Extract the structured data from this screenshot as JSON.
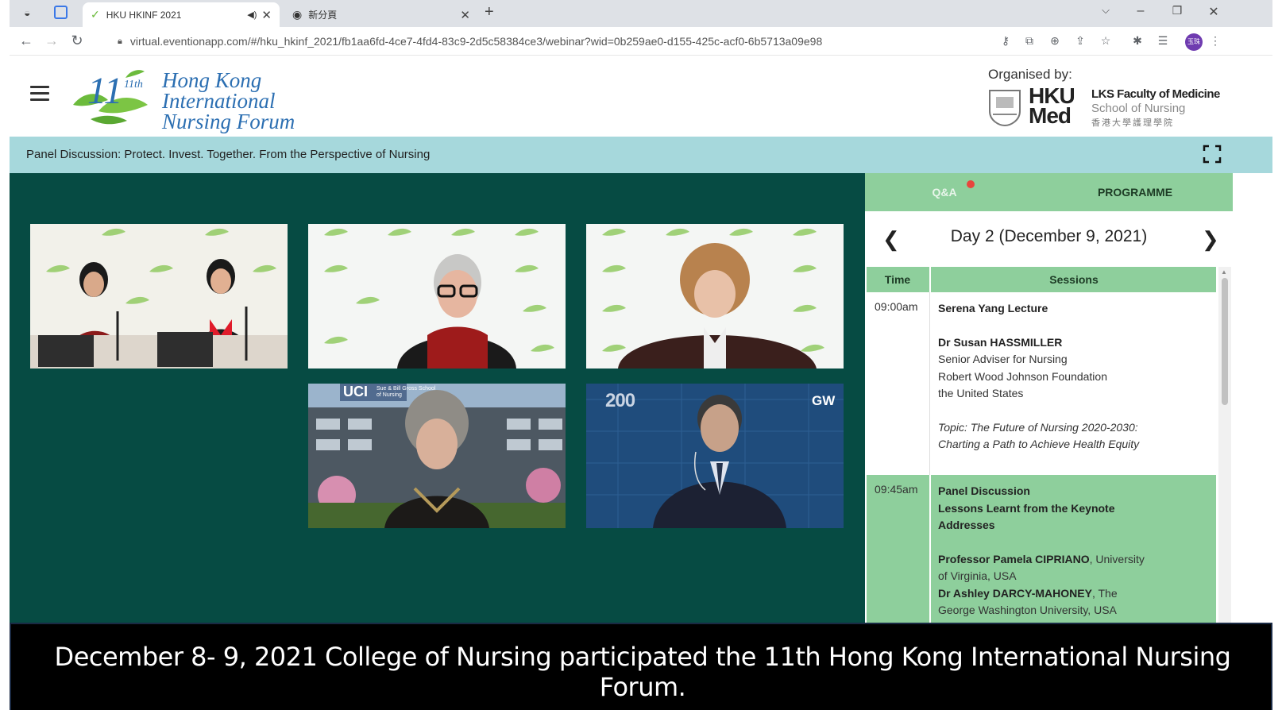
{
  "browser": {
    "active_tab_title": "HKU HKINF 2021",
    "new_tab_title": "新分頁",
    "url": "virtual.eventionapp.com/#/hku_hkinf_2021/fb1aa6fd-4ce7-4fd4-83c9-2d5c58384ce3/webinar?wid=0b259ae0-d155-425c-acf0-6b5713a09e98",
    "profile_initials": "玉珠"
  },
  "header": {
    "logo_text": [
      "Hong Kong",
      "International",
      "Nursing Forum"
    ],
    "logo_edition": "11th",
    "organised_by": "Organised by:",
    "org_hku": "HKU",
    "org_med": "Med",
    "org_faculty": "LKS Faculty of Medicine",
    "org_school": "School of Nursing",
    "org_chinese": "香港大學護理學院"
  },
  "session": {
    "title": "Panel Discussion: Protect. Invest. Together. From the Perspective of Nursing"
  },
  "video_tiles": {
    "uci_label": "UCI",
    "uci_sub": "Sue & Bill Gross School of Nursing",
    "gw_label": "GW",
    "gw_anniv": "200"
  },
  "panel": {
    "tab_qa": "Q&A",
    "tab_programme": "PROGRAMME",
    "day_title": "Day 2 (December 9, 2021)",
    "col_time": "Time",
    "col_sessions": "Sessions",
    "rows": [
      {
        "time": "09:00am",
        "lecture": "Serena Yang Lecture",
        "speaker": "Dr Susan HASSMILLER",
        "role": "Senior Adviser for Nursing",
        "org": "Robert Wood Johnson Foundation",
        "country": "the United States",
        "topic": "Topic: The Future of Nursing 2020-2030: Charting a Path to Achieve Health Equity"
      },
      {
        "time": "09:45am",
        "type": "Panel Discussion",
        "title": "Lessons Learnt from the Keynote Addresses",
        "p1_name": "Professor Pamela CIPRIANO",
        "p1_aff": ", University of Virginia, USA",
        "p2_name": "Dr Ashley DARCY-MAHONEY",
        "p2_aff": ", The George Washington University, USA"
      }
    ]
  },
  "caption": "December 8- 9, 2021 College of Nursing participated the 11th Hong Kong International Nursing Forum.",
  "colors": {
    "video_bg": "#064b43",
    "title_bar": "#a6d8dc",
    "panel_green": "#8ecf9c",
    "logo_blue": "#2c6fb2",
    "logo_green": "#6cbb3c"
  }
}
